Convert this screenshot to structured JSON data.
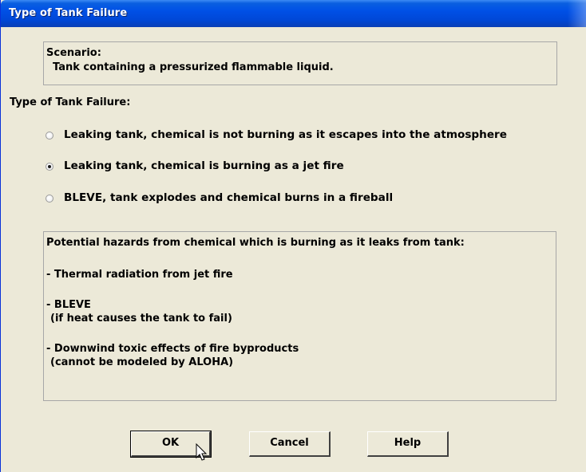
{
  "window": {
    "title": "Type of Tank Failure"
  },
  "scenario": {
    "label": "Scenario:",
    "text": "Tank containing a pressurized flammable liquid."
  },
  "failure_type": {
    "heading": "Type of Tank Failure:",
    "options": [
      {
        "label": "Leaking tank, chemical is not burning as it escapes into the atmosphere",
        "selected": false
      },
      {
        "label": "Leaking tank, chemical is burning as a jet fire",
        "selected": true
      },
      {
        "label": "BLEVE, tank explodes and chemical burns in a fireball",
        "selected": false
      }
    ]
  },
  "hazards": {
    "intro": "Potential hazards from chemical which is burning as it leaks from tank:",
    "items": [
      {
        "line1": "- Thermal radiation from jet fire"
      },
      {
        "line1": "- BLEVE",
        "line2": "(if heat causes the tank to fail)"
      },
      {
        "line1": "- Downwind toxic effects of fire byproducts",
        "line2": "(cannot be modeled by ALOHA)"
      }
    ]
  },
  "buttons": {
    "ok": "OK",
    "cancel": "Cancel",
    "help": "Help"
  },
  "icons": {
    "cursor": "mouse-pointer-icon"
  }
}
